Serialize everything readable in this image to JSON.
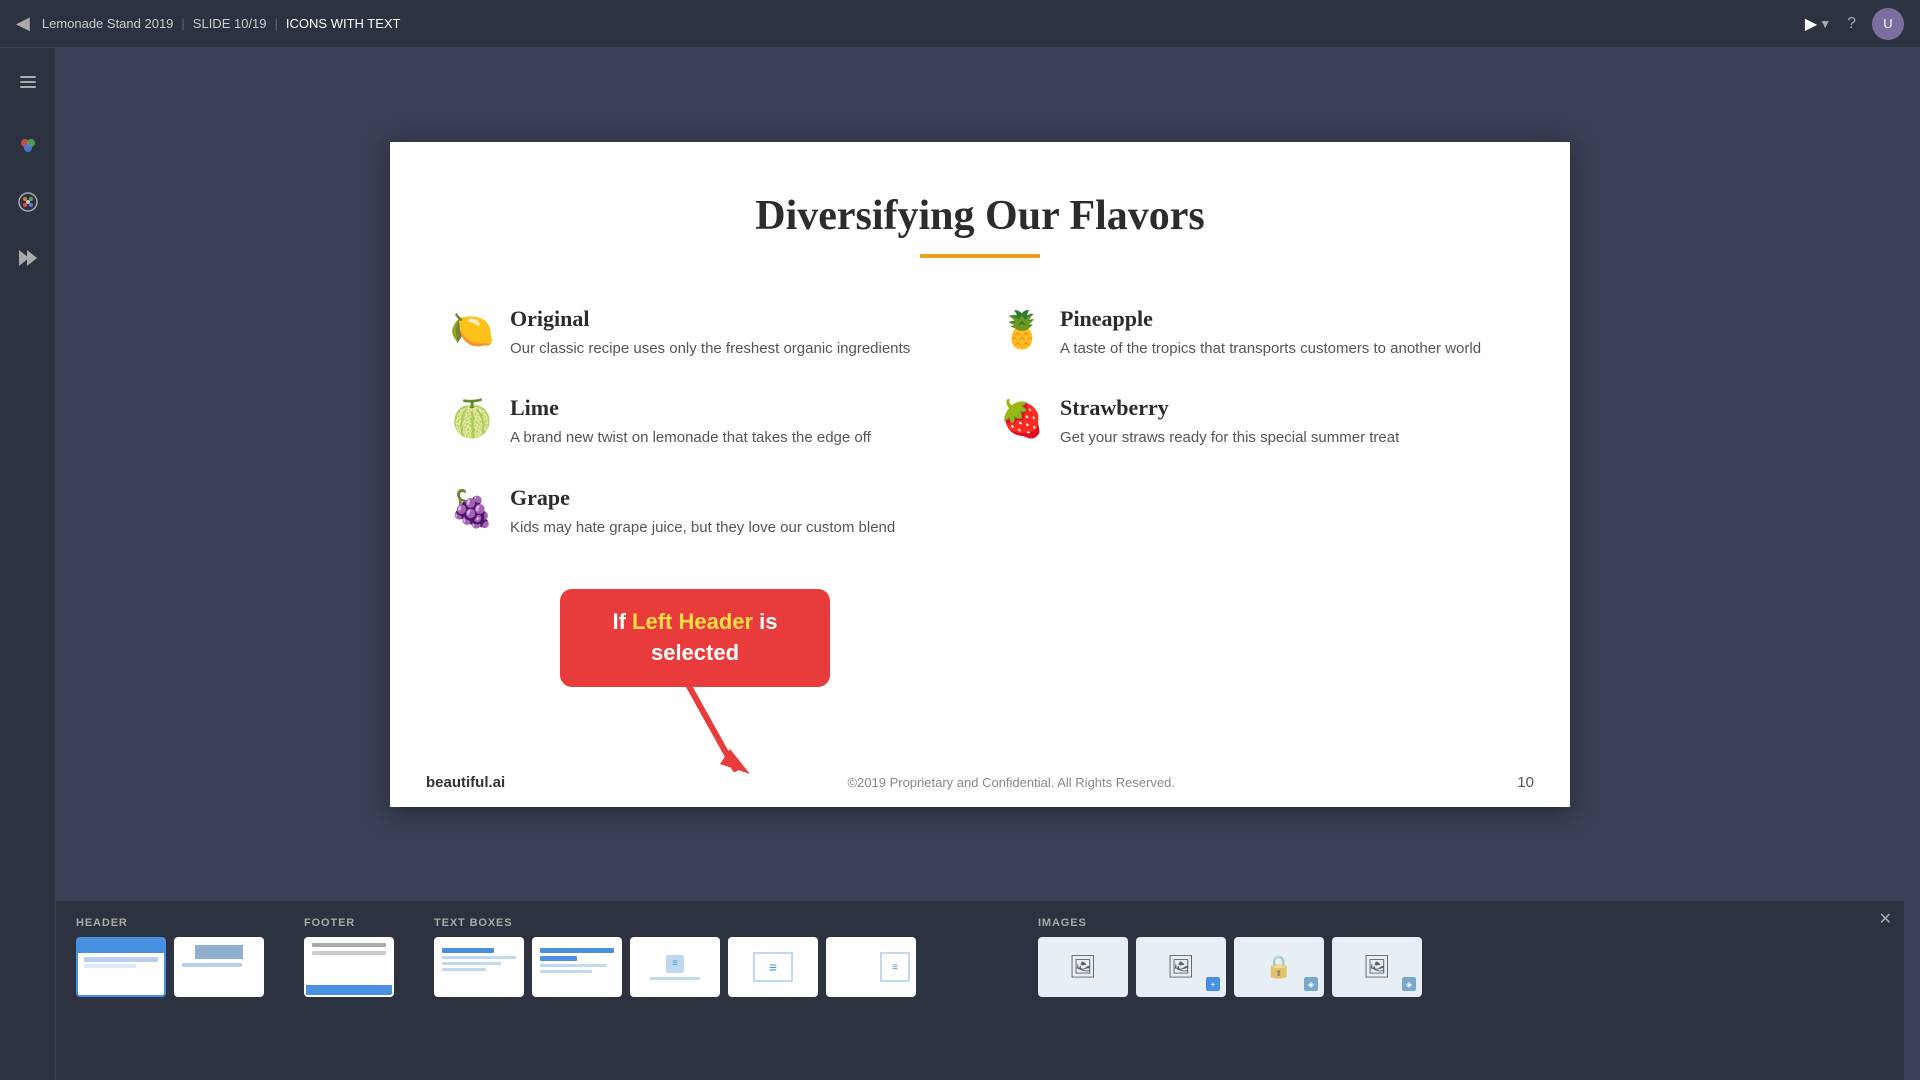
{
  "topbar": {
    "back_icon": "◀",
    "project": "Lemonade Stand 2019",
    "slide_label": "SLIDE 10/19",
    "slide_name": "ICONS WITH TEXT",
    "play_icon": "▶",
    "help_icon": "?",
    "avatar_initials": "U"
  },
  "sidebar": {
    "menu_icon": "☰",
    "palette_icon": "⬡",
    "brush_icon": "🎨",
    "forward_icon": "⏩"
  },
  "slide": {
    "title": "Diversifying Our Flavors",
    "items": [
      {
        "icon": "🍋",
        "icon_class": "icon-lemon",
        "title": "Original",
        "description": "Our classic recipe uses only the freshest organic ingredients"
      },
      {
        "icon": "🍍",
        "icon_class": "icon-pineapple",
        "title": "Pineapple",
        "description": "A taste of the tropics that transports customers to another world"
      },
      {
        "icon": "🍈",
        "icon_class": "icon-lime",
        "title": "Lime",
        "description": "A brand new twist on lemonade that takes the edge off"
      },
      {
        "icon": "🍓",
        "icon_class": "icon-strawberry",
        "title": "Strawberry",
        "description": "Get your straws ready for this special summer treat"
      },
      {
        "icon": "🍇",
        "icon_class": "icon-grape",
        "title": "Grape",
        "description": "Kids may hate grape juice, but they love our custom blend"
      }
    ],
    "footer": {
      "brand": "beautiful.ai",
      "copyright": "©2019 Proprietary and Confidential. All Rights Reserved.",
      "page_number": "10"
    }
  },
  "tooltip": {
    "text_before": "If ",
    "highlight": "Left Header",
    "text_after": " is selected"
  },
  "bottom_panel": {
    "sections": [
      {
        "label": "HEADER"
      },
      {
        "label": "FOOTER"
      },
      {
        "label": "TEXT BOXES"
      },
      {
        "label": "IMAGES"
      }
    ],
    "close_icon": "✕"
  }
}
